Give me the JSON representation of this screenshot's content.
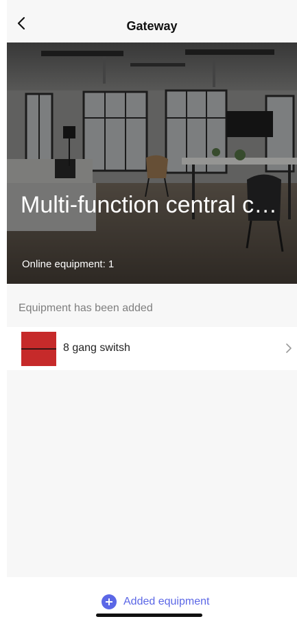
{
  "header": {
    "title": "Gateway",
    "back_icon": "chevron-left-icon"
  },
  "hero": {
    "title": "Multi-function central c…",
    "online_text": "Online equipment: 1"
  },
  "section": {
    "label": "Equipment has been added"
  },
  "devices": [
    {
      "name": "8 gang switsh",
      "color": "#c62a2a",
      "chevron_icon": "chevron-right-icon"
    }
  ],
  "footer": {
    "add_label": "Added equipment",
    "accent": "#5b67e6"
  }
}
